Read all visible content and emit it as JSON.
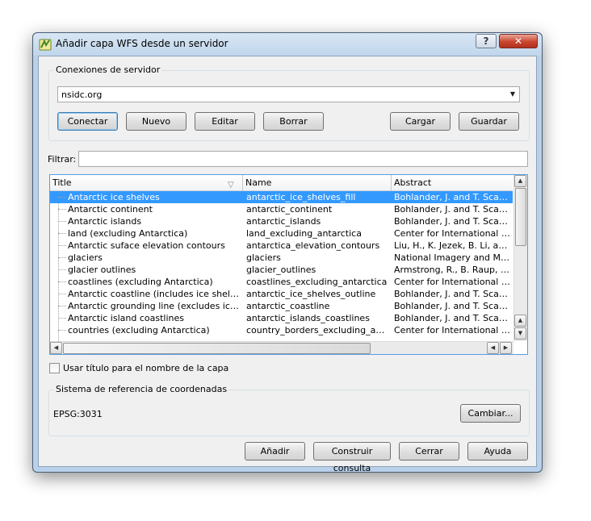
{
  "window": {
    "title": "Añadir capa WFS desde un servidor",
    "help_label": "?",
    "close_label": "✕"
  },
  "connections": {
    "group_label": "Conexiones de servidor",
    "selected": "nsidc.org",
    "buttons": {
      "connect": "Conectar",
      "new": "Nuevo",
      "edit": "Editar",
      "delete": "Borrar",
      "load": "Cargar",
      "save": "Guardar"
    }
  },
  "filter": {
    "label": "Filtrar:",
    "value": ""
  },
  "table": {
    "columns": [
      "Title",
      "Name",
      "Abstract"
    ],
    "rows": [
      {
        "title": "Antarctic ice shelves",
        "name": "antarctic_ice_shelves_fill",
        "abstract": "Bohlander, J. and T. Scambo..."
      },
      {
        "title": "Antarctic continent",
        "name": "antarctic_continent",
        "abstract": "Bohlander, J. and T. Scambo..."
      },
      {
        "title": "Antarctic islands",
        "name": "antarctic_islands",
        "abstract": "Bohlander, J. and T. Scambo..."
      },
      {
        "title": "land (excluding Antarctica)",
        "name": "land_excluding_antarctica",
        "abstract": "Center for International Ear..."
      },
      {
        "title": "Antarctic suface elevation contours",
        "name": "antarctica_elevation_contours",
        "abstract": "Liu, H., K. Jezek, B. Li, and ..."
      },
      {
        "title": "glaciers",
        "name": "glaciers",
        "abstract": "National Imagery and Mappi..."
      },
      {
        "title": "glacier outlines",
        "name": "glacier_outlines",
        "abstract": "Armstrong, R., B. Raup, S.J...."
      },
      {
        "title": "coastlines (excluding Antarctica)",
        "name": "coastlines_excluding_antarctica",
        "abstract": "Center for International Ear..."
      },
      {
        "title": "Antarctic coastline (includes ice shelves)",
        "name": "antarctic_ice_shelves_outline",
        "abstract": "Bohlander, J. and T. Scambo..."
      },
      {
        "title": "Antarctic grounding line (excludes ice shel...",
        "name": "antarctic_coastline",
        "abstract": "Bohlander, J. and T. Scambo..."
      },
      {
        "title": "Antarctic island coastlines",
        "name": "antarctic_islands_coastlines",
        "abstract": "Bohlander, J. and T. Scambo..."
      },
      {
        "title": "countries (excluding Antarctica)",
        "name": "country_borders_excluding_antarc...",
        "abstract": "Center for International Ear..."
      }
    ],
    "selected_index": 0
  },
  "use_title_checkbox": {
    "label": "Usar título para el nombre de la capa",
    "checked": false
  },
  "crs": {
    "group_label": "Sistema de referencia de coordenadas",
    "value": "EPSG:3031",
    "change_label": "Cambiar..."
  },
  "footer": {
    "add": "Añadir",
    "build_query": "Construir consulta",
    "close": "Cerrar",
    "help": "Ayuda"
  },
  "colors": {
    "selection": "#3399ff",
    "window_frame": "#b9d1ea",
    "focus_border": "#569de5"
  },
  "icons": {
    "app": "qgis-icon",
    "sort": "sort-indicator-icon"
  }
}
